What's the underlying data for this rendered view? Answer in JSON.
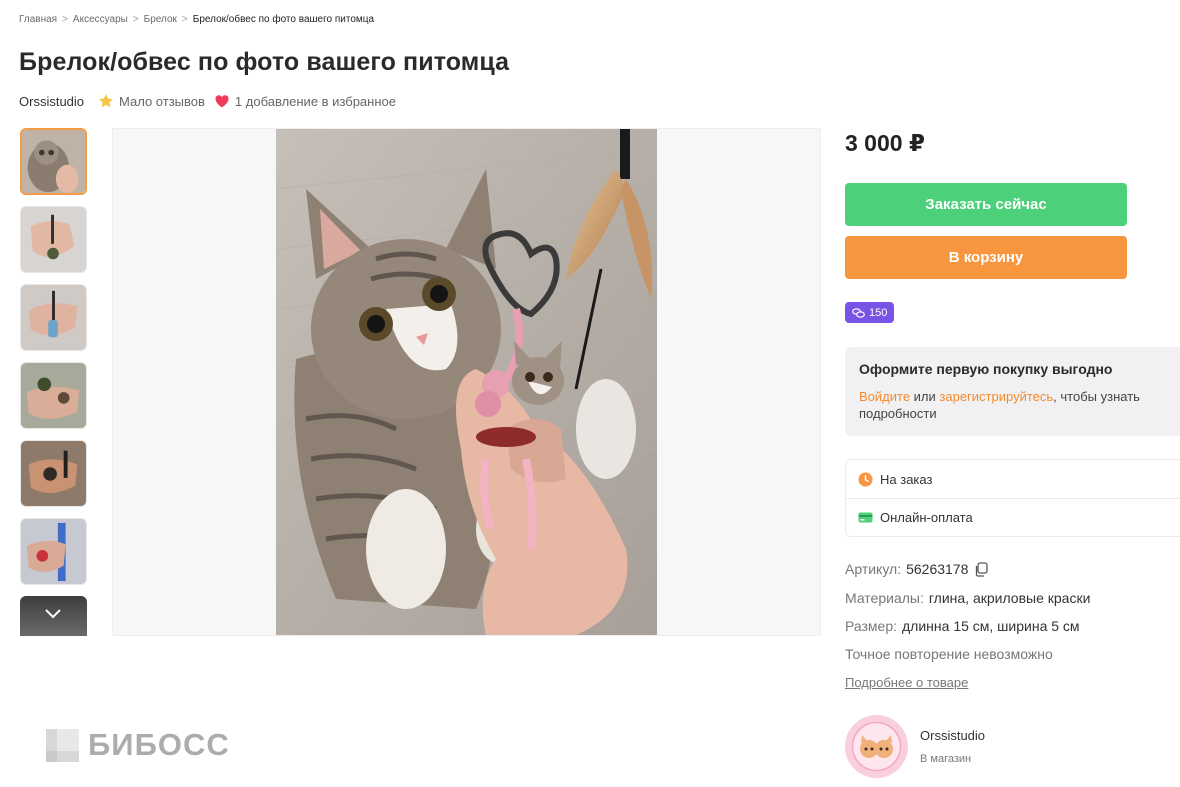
{
  "breadcrumb": {
    "items": [
      "Главная",
      "Аксессуары",
      "Брелок"
    ],
    "current": "Брелок/обвес по фото вашего питомца",
    "separator": ">"
  },
  "product": {
    "title": "Брелок/обвес по фото вашего питомца",
    "shop_name": "Orssistudio",
    "reviews_text": "Мало отзывов",
    "favorites_text": "1 добавление в избранное",
    "price": "3 000 ₽",
    "bonus": "150"
  },
  "buttons": {
    "order_now": "Заказать сейчас",
    "add_to_cart": "В корзину"
  },
  "promo": {
    "title": "Оформите первую покупку выгодно",
    "login_link": "Войдите",
    "or": " или ",
    "register_link": "зарегистрируйтесь",
    "tail": ", чтобы узнать подробности"
  },
  "features": [
    {
      "icon": "clock-icon",
      "label": "На заказ"
    },
    {
      "icon": "card-icon",
      "label": "Онлайн-оплата"
    }
  ],
  "specs": {
    "article_label": "Артикул:",
    "article_value": "56263178",
    "materials_label": "Материалы:",
    "materials_value": "глина, акриловые краски",
    "size_label": "Размер:",
    "size_value": "длинна 15 см, ширина 5 см",
    "note": "Точное повторение невозможно",
    "more_link": "Подробнее о товаре"
  },
  "seller": {
    "name": "Orssistudio",
    "store_link": "В магазин"
  },
  "watermark": "БИБОСС",
  "colors": {
    "order_button": "#4cd07a",
    "cart_button": "#f7963e",
    "bonus_badge": "#7b52e6",
    "link_orange": "#f58a2a",
    "active_thumb_border": "#f59a46"
  }
}
